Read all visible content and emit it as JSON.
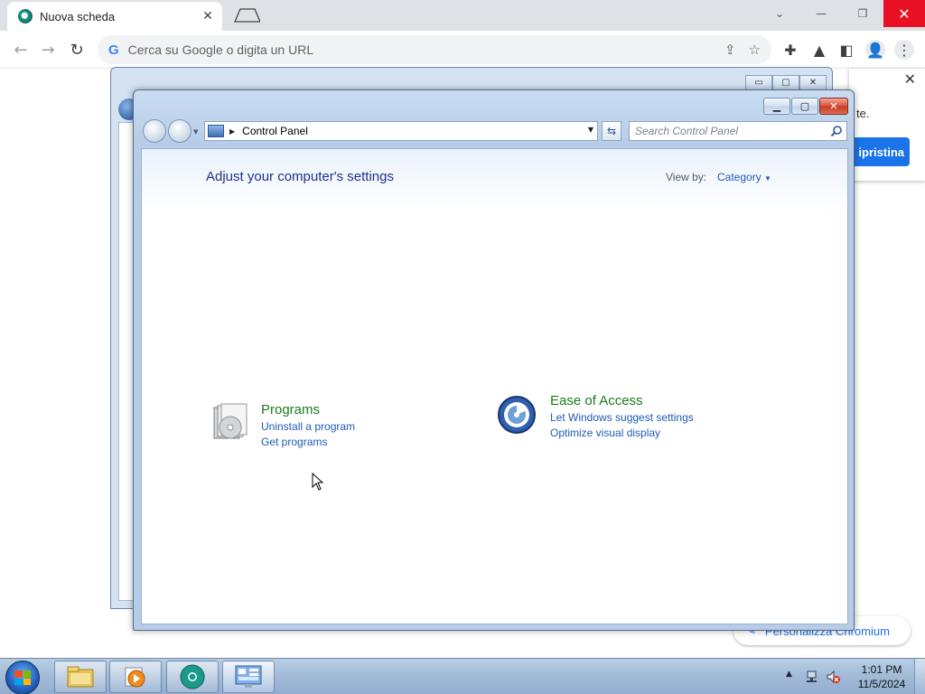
{
  "browser": {
    "tab_title": "Nuova scheda",
    "omnibox_placeholder": "Cerca su Google o digita un URL",
    "google_letter": "G"
  },
  "chrome_popup": {
    "text": "te.",
    "button": "ipristina"
  },
  "personalize_chip": {
    "label": "Personalizza Chromium"
  },
  "control_panel": {
    "breadcrumb": "Control Panel",
    "search_placeholder": "Search Control Panel",
    "heading": "Adjust your computer's settings",
    "view_by_label": "View by:",
    "view_by_value": "Category",
    "categories": [
      {
        "title": "Programs",
        "icon": "programs-icon",
        "links": [
          "Uninstall a program",
          "Get programs"
        ]
      },
      {
        "title": "Ease of Access",
        "icon": "ease-of-access-icon",
        "links": [
          "Let Windows suggest settings",
          "Optimize visual display"
        ]
      }
    ]
  },
  "taskbar": {
    "items": [
      "file-explorer",
      "media-player",
      "chromium",
      "control-panel"
    ],
    "time": "1:01 PM",
    "date": "11/5/2024"
  },
  "colors": {
    "link": "#1e5bb5",
    "category_title": "#1c7a1c",
    "heading": "#1e3287",
    "chrome_close": "#e81123"
  }
}
